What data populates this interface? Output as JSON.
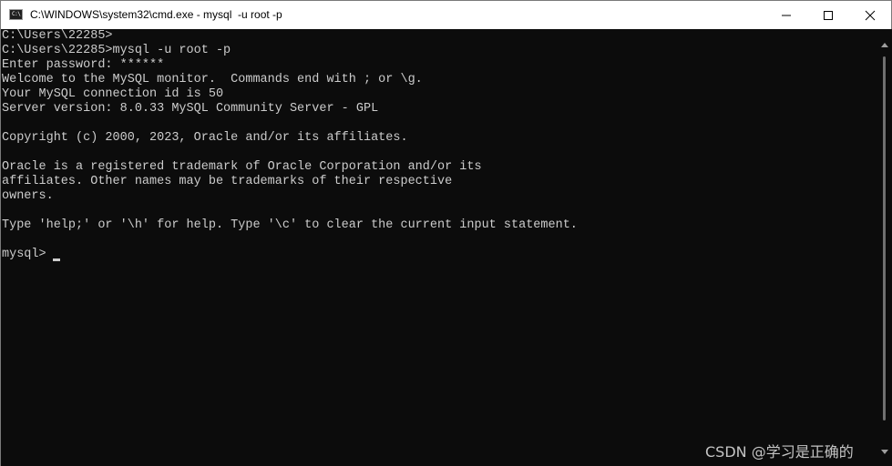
{
  "window": {
    "title": "C:\\WINDOWS\\system32\\cmd.exe - mysql  -u root -p",
    "app_icon": "cmd-icon",
    "app_icon_text": "C:\\",
    "controls": {
      "minimize_icon": "minimize-icon",
      "maximize_icon": "maximize-icon",
      "close_icon": "close-icon"
    }
  },
  "terminal": {
    "lines": [
      "C:\\Users\\22285>",
      "C:\\Users\\22285>mysql -u root -p",
      "Enter password: ******",
      "Welcome to the MySQL monitor.  Commands end with ; or \\g.",
      "Your MySQL connection id is 50",
      "Server version: 8.0.33 MySQL Community Server - GPL",
      "",
      "Copyright (c) 2000, 2023, Oracle and/or its affiliates.",
      "",
      "Oracle is a registered trademark of Oracle Corporation and/or its",
      "affiliates. Other names may be trademarks of their respective",
      "owners.",
      "",
      "Type 'help;' or '\\h' for help. Type '\\c' to clear the current input statement.",
      "",
      "mysql> "
    ],
    "text_color": "#cccccc",
    "background_color": "#0c0c0c"
  },
  "watermark": "CSDN @学习是正确的"
}
